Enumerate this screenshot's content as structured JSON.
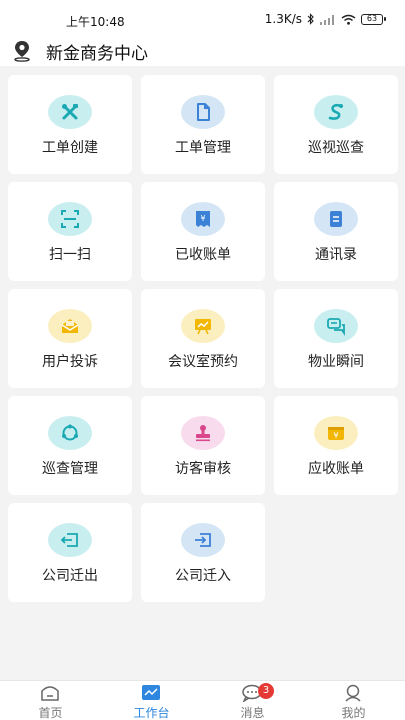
{
  "status_bar": {
    "time": "上午10:48",
    "network_speed": "1.3K/s",
    "battery": "63"
  },
  "header": {
    "location_icon": "location-pin-icon",
    "title": "新金商务中心"
  },
  "colors": {
    "accent": "#2e86de",
    "teal": "#20b5bd",
    "blue": "#3b82d6",
    "yellow": "#f2b705",
    "pink": "#d9468c",
    "badge": "#e53935"
  },
  "grid": {
    "items": [
      {
        "label": "工单创建",
        "icon": "tools-icon"
      },
      {
        "label": "工单管理",
        "icon": "document-icon"
      },
      {
        "label": "巡视巡查",
        "icon": "patrol-route-icon"
      },
      {
        "label": "扫一扫",
        "icon": "scan-icon"
      },
      {
        "label": "已收账单",
        "icon": "received-bill-icon"
      },
      {
        "label": "通讯录",
        "icon": "contacts-icon"
      },
      {
        "label": "用户投诉",
        "icon": "complaint-mail-icon"
      },
      {
        "label": "会议室预约",
        "icon": "meeting-board-icon"
      },
      {
        "label": "物业瞬间",
        "icon": "chat-bubbles-icon"
      },
      {
        "label": "巡查管理",
        "icon": "cycle-icon"
      },
      {
        "label": "访客审核",
        "icon": "stamp-icon"
      },
      {
        "label": "应收账单",
        "icon": "receivable-bill-icon"
      },
      {
        "label": "公司迁出",
        "icon": "move-out-icon"
      },
      {
        "label": "公司迁入",
        "icon": "move-in-icon"
      }
    ]
  },
  "tabbar": {
    "tabs": [
      {
        "label": "首页",
        "icon": "home-icon",
        "active": false
      },
      {
        "label": "工作台",
        "icon": "workbench-icon",
        "active": true
      },
      {
        "label": "消息",
        "icon": "message-icon",
        "active": false,
        "badge": "3"
      },
      {
        "label": "我的",
        "icon": "profile-icon",
        "active": false
      }
    ]
  }
}
